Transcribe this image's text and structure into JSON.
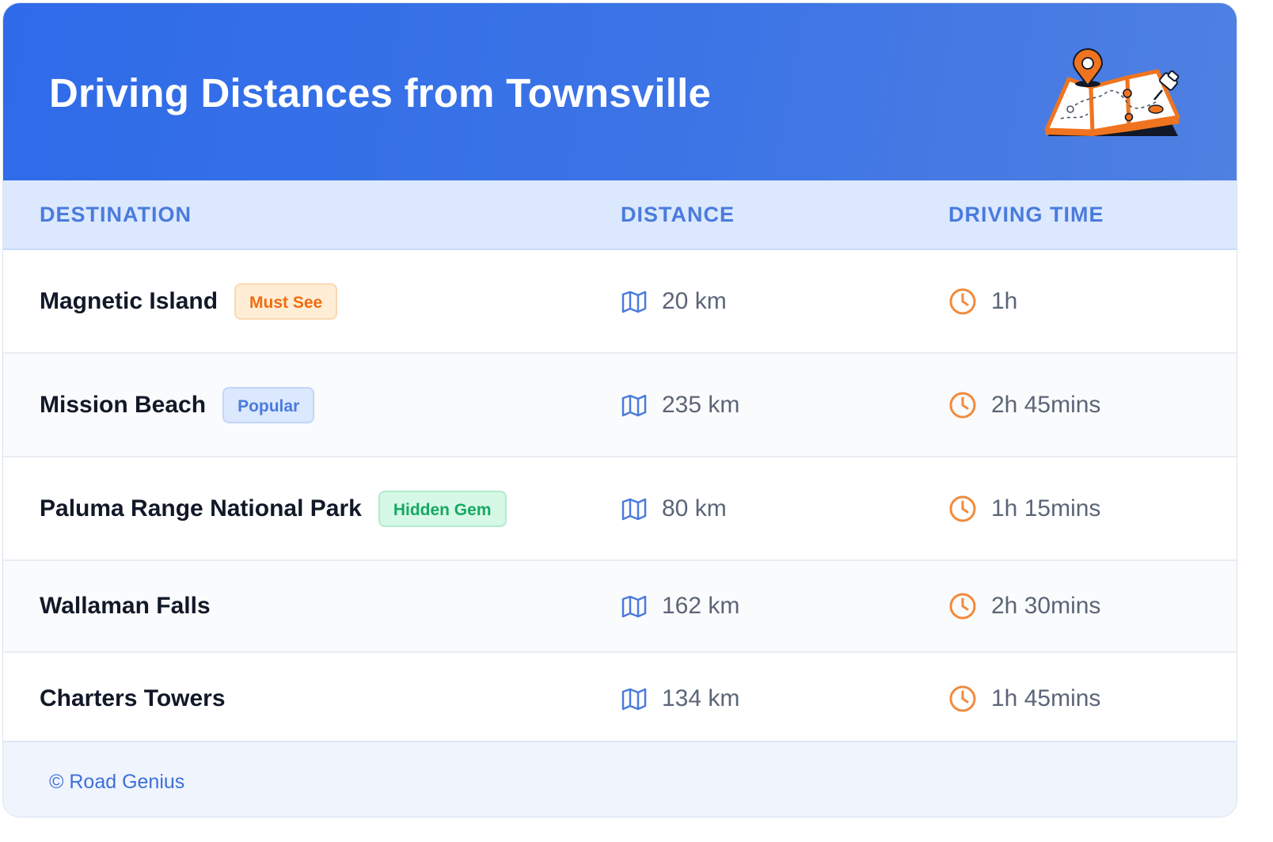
{
  "header": {
    "title": "Driving Distances from Townsville",
    "illustration_icon": "map-with-pins-illustration"
  },
  "columns": {
    "destination": "DESTINATION",
    "distance": "DISTANCE",
    "time": "DRIVING TIME"
  },
  "rows": [
    {
      "destination": "Magnetic Island",
      "badge": "Must See",
      "badge_color": "#f06c10",
      "distance": "20 km",
      "time": "1h"
    },
    {
      "destination": "Mission Beach",
      "badge": "Popular",
      "badge_color": "#4a7bdc",
      "distance": "235 km",
      "time": "2h 45mins"
    },
    {
      "destination": "Paluma Range National Park",
      "badge": "Hidden Gem",
      "badge_color": "#17a862",
      "distance": "80 km",
      "time": "1h 15mins"
    },
    {
      "destination": "Wallaman Falls",
      "badge": "",
      "distance": "162 km",
      "time": "2h 30mins"
    },
    {
      "destination": "Charters Towers",
      "badge": "",
      "distance": "134 km",
      "time": "1h 45mins"
    }
  ],
  "icons": {
    "distance": "map-icon",
    "time": "clock-icon"
  },
  "colors": {
    "header_gradient_start": "#2f6be9",
    "header_gradient_end": "#4f80e2",
    "accent_blue": "#4a7bdc",
    "accent_orange": "#f28a3c"
  },
  "footer": {
    "credit": "© Road Genius"
  }
}
